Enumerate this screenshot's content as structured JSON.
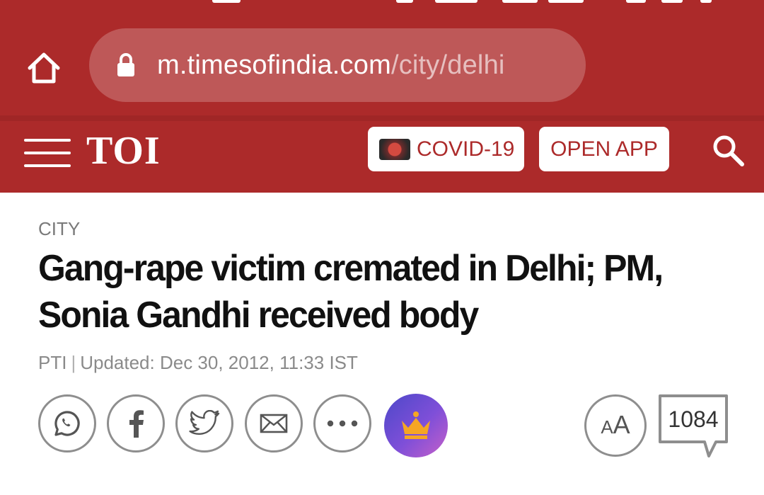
{
  "browser": {
    "url_host": "m.timesofindia.com",
    "url_path": "/city/delhi"
  },
  "header": {
    "logo": "TOI",
    "covid_label": "COVID-19",
    "open_app_label": "OPEN APP"
  },
  "article": {
    "section": "CITY",
    "headline": "Gang-rape victim cremated in Delhi; PM, Sonia Gandhi received body",
    "source": "PTI",
    "separator": "|",
    "updated": "Updated: Dec 30, 2012, 11:33 IST"
  },
  "actions": {
    "share_icons": [
      "whatsapp-icon",
      "facebook-icon",
      "twitter-icon",
      "mail-icon",
      "more-icon",
      "crown-icon"
    ],
    "font_size_label_small": "A",
    "font_size_label_large": "A",
    "comment_count": "1084"
  },
  "colors": {
    "brand_red": "#ac2a2a",
    "premium_gradient_start": "#4c48c9",
    "premium_gradient_end": "#c660c9",
    "muted_text": "#8a8a8a"
  }
}
